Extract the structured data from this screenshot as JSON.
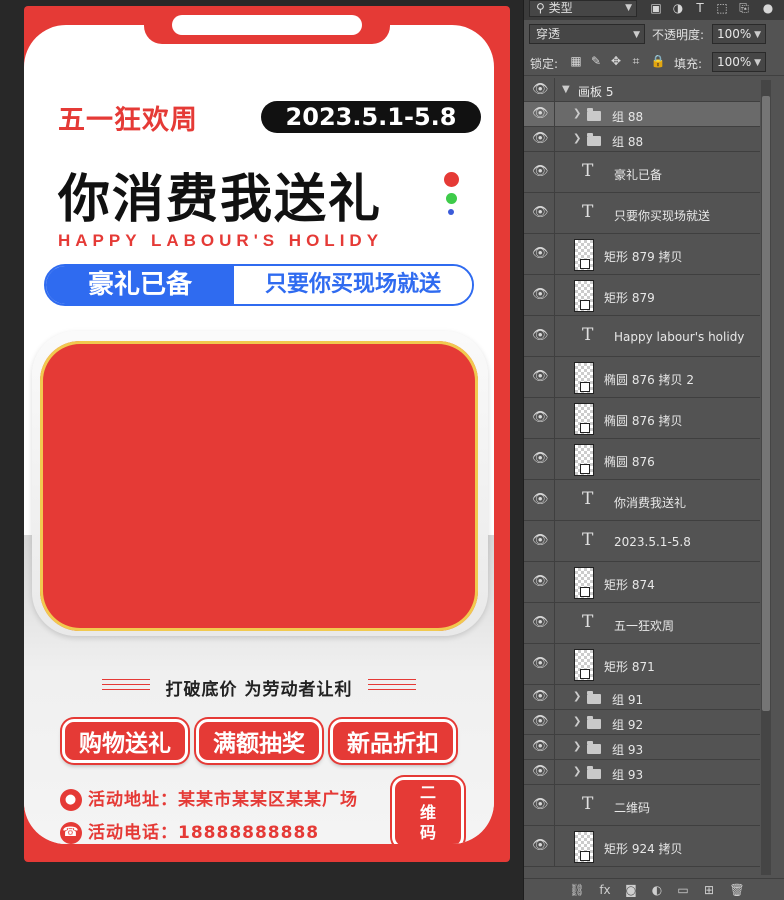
{
  "poster": {
    "week_title": "五一狂欢周",
    "date_range": "2023.5.1-5.8",
    "headline": "你消费我送礼",
    "sub_english": "HAPPY LABOUR'S HOLIDY",
    "pill_left": "豪礼已备",
    "pill_right": "只要你买现场就送",
    "slogan": "打破底价  为劳动者让利",
    "buttons": [
      "购物送礼",
      "满额抽奖",
      "新品折扣"
    ],
    "address": "活动地址：某某市某某区某某广场",
    "phone": "活动电话：18888888888",
    "qr_label": "二维码",
    "colors": {
      "brand_red": "#e53a36",
      "accent_blue": "#2f6bf0",
      "black": "#111111"
    }
  },
  "layers_panel": {
    "filter_kind": "类型",
    "blend_mode": "穿透",
    "opacity_label": "不透明度:",
    "opacity_value": "100%",
    "lock_label": "锁定:",
    "fill_label": "填充:",
    "fill_value": "100%",
    "artboard_name": "画板 5",
    "layers": [
      {
        "name": "组 88",
        "type": "group",
        "selected": true
      },
      {
        "name": "组 88",
        "type": "group",
        "selected": false
      },
      {
        "name": "豪礼已备",
        "type": "text",
        "selected": false
      },
      {
        "name": "只要你买现场就送",
        "type": "text",
        "selected": false
      },
      {
        "name": "矩形 879 拷贝",
        "type": "shape",
        "selected": false
      },
      {
        "name": "矩形 879",
        "type": "shape",
        "selected": false
      },
      {
        "name": "Happy labour's holidy",
        "type": "text",
        "selected": false
      },
      {
        "name": "椭圆 876 拷贝 2",
        "type": "shape",
        "selected": false
      },
      {
        "name": "椭圆 876 拷贝",
        "type": "shape",
        "selected": false
      },
      {
        "name": "椭圆 876",
        "type": "shape",
        "selected": false
      },
      {
        "name": "你消费我送礼",
        "type": "text",
        "selected": false
      },
      {
        "name": "2023.5.1-5.8",
        "type": "text",
        "selected": false
      },
      {
        "name": "矩形 874",
        "type": "shape",
        "selected": false
      },
      {
        "name": "五一狂欢周",
        "type": "text",
        "selected": false
      },
      {
        "name": "矩形 871",
        "type": "shape",
        "selected": false
      },
      {
        "name": "组 91",
        "type": "group",
        "selected": false
      },
      {
        "name": "组 92",
        "type": "group",
        "selected": false
      },
      {
        "name": "组 93",
        "type": "group",
        "selected": false
      },
      {
        "name": "组 93",
        "type": "group",
        "selected": false
      },
      {
        "name": "二维码",
        "type": "text",
        "selected": false
      },
      {
        "name": "矩形 924 拷贝",
        "type": "shape",
        "selected": false
      }
    ],
    "icons": {
      "eye": "eye-icon",
      "folder": "folder-icon",
      "text": "text-layer-icon",
      "link": "link-layers-icon",
      "fx": "layer-style-icon",
      "mask": "add-mask-icon",
      "adjust": "adjustment-layer-icon",
      "new_group": "new-group-icon",
      "new_layer": "new-layer-icon",
      "delete": "delete-layer-icon"
    }
  }
}
